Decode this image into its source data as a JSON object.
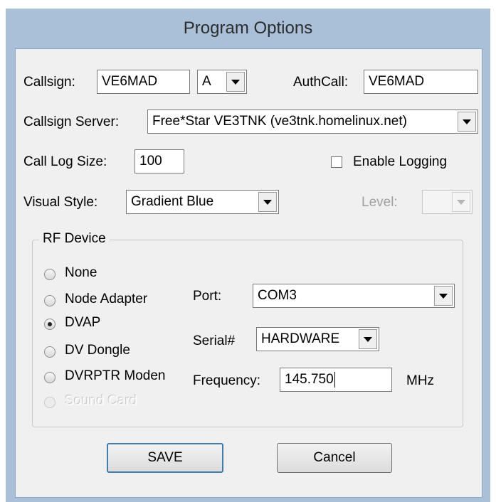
{
  "window": {
    "title": "Program Options"
  },
  "callsign": {
    "label": "Callsign:",
    "value": "VE6MAD",
    "suffix": "A"
  },
  "authcall": {
    "label": "AuthCall:",
    "value": "VE6MAD"
  },
  "server": {
    "label": "Callsign Server:",
    "value": "Free*Star VE3TNK (ve3tnk.homelinux.net)"
  },
  "call_log": {
    "label": "Call Log Size:",
    "value": "100"
  },
  "logging": {
    "label": "Enable Logging",
    "checked": false
  },
  "visual_style": {
    "label": "Visual Style:",
    "value": "Gradient Blue"
  },
  "level": {
    "label": "Level:",
    "value": ""
  },
  "rf_device": {
    "title": "RF Device",
    "options": [
      "None",
      "Node Adapter",
      "DVAP",
      "DV Dongle",
      "DVRPTR Moden",
      "Sound Card"
    ],
    "selected": "DVAP"
  },
  "port": {
    "label": "Port:",
    "value": "COM3"
  },
  "serial": {
    "label": "Serial#",
    "value": "HARDWARE"
  },
  "frequency": {
    "label": "Frequency:",
    "value": "145.750",
    "unit": "MHz"
  },
  "buttons": {
    "save": "SAVE",
    "cancel": "Cancel"
  }
}
